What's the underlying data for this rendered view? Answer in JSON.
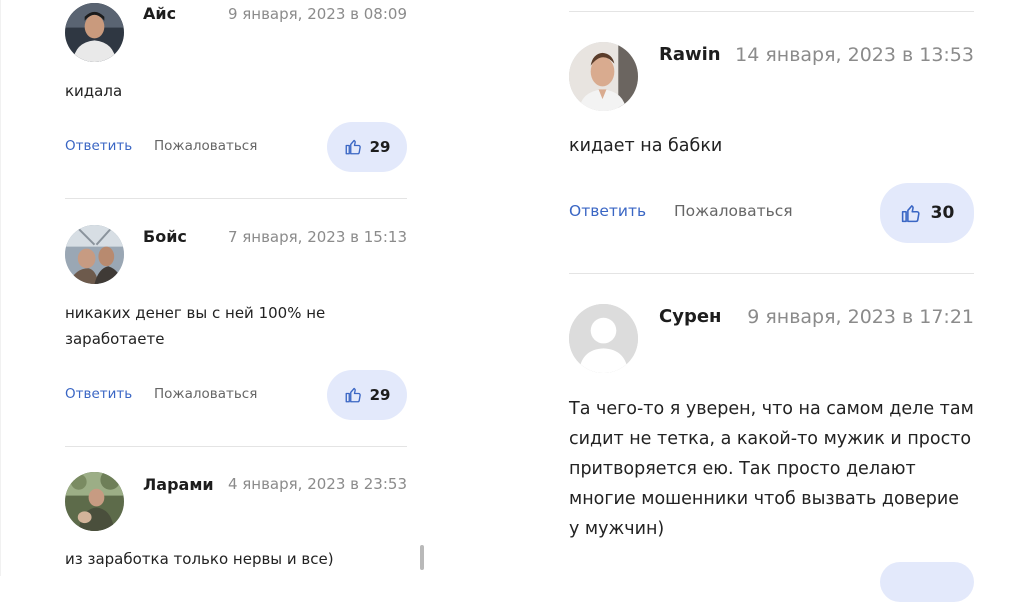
{
  "left_column": {
    "comments": [
      {
        "author": "Айс",
        "date": "9 января, 2023 в 08:09",
        "text": "кидала",
        "reply_label": "Ответить",
        "report_label": "Пожаловаться",
        "likes": "29"
      },
      {
        "author": "Бойс",
        "date": "7 января, 2023 в 15:13",
        "text": "никаких денег вы с ней 100% не заработаете",
        "reply_label": "Ответить",
        "report_label": "Пожаловаться",
        "likes": "29"
      },
      {
        "author": "Ларами",
        "date": "4 января, 2023 в 23:53",
        "text": "из заработка только нервы и все)"
      }
    ]
  },
  "right_column": {
    "comments": [
      {
        "author": "Rawin",
        "date": "14 января, 2023 в 13:53",
        "text": "кидает на бабки",
        "reply_label": "Ответить",
        "report_label": "Пожаловаться",
        "likes": "30"
      },
      {
        "author": "Сурен",
        "date": "9 января, 2023 в 17:21",
        "text": "Та чего-то я уверен, что на самом деле там сидит не тетка, а какой-то мужик и просто притворяется ею. Так просто делают многие мошенники чтоб вызвать доверие у мужчин)"
      }
    ]
  },
  "colors": {
    "link": "#3a66c4",
    "like_bg": "#e3e9fb",
    "date": "#8b8b8b",
    "divider": "#e4e4e4"
  },
  "icons": {
    "like": "thumbs-up-icon",
    "default_avatar": "user-placeholder-icon"
  }
}
